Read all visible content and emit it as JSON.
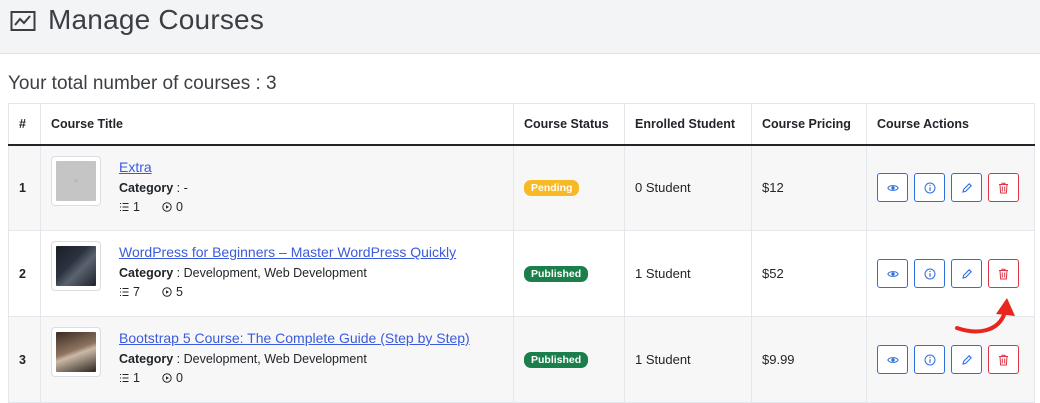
{
  "header": {
    "title": "Manage Courses",
    "icon": "chart-line-icon"
  },
  "summary": {
    "text": "Your total number of courses : 3"
  },
  "table": {
    "columns": [
      "#",
      "Course Title",
      "Course Status",
      "Enrolled Student",
      "Course Pricing",
      "Course Actions"
    ],
    "rows": [
      {
        "num": "1",
        "title": "Extra",
        "category_label": "Category",
        "category_value": " : -",
        "lessons": "1",
        "videos": "0",
        "status": "Pending",
        "enrolled": "0 Student",
        "price": "$12"
      },
      {
        "num": "2",
        "title": "WordPress for Beginners – Master WordPress Quickly",
        "category_label": "Category",
        "category_value": " : Development, Web Development",
        "lessons": "7",
        "videos": "5",
        "status": "Published",
        "enrolled": "1 Student",
        "price": "$52"
      },
      {
        "num": "3",
        "title": "Bootstrap 5 Course: The Complete Guide (Step by Step)",
        "category_label": "Category",
        "category_value": " : Development, Web Development",
        "lessons": "1",
        "videos": "0",
        "status": "Published",
        "enrolled": "1 Student",
        "price": "$9.99"
      }
    ]
  },
  "colors": {
    "accent": "#2f6fdd",
    "danger": "#dc3545",
    "pending": "#f7b924",
    "published": "#1a7f4b",
    "annotation": "#e8261e"
  }
}
